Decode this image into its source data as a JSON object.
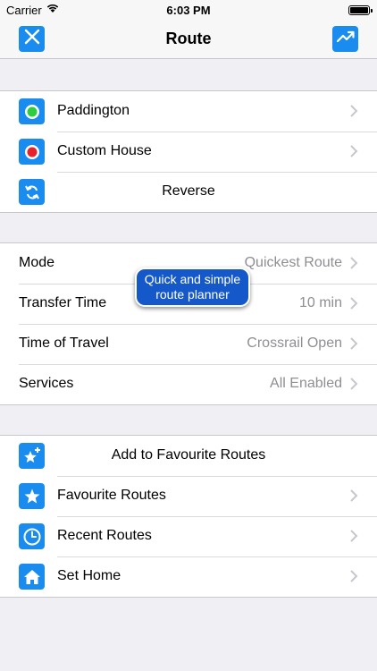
{
  "status_bar": {
    "carrier": "Carrier",
    "time": "6:03 PM"
  },
  "nav": {
    "title": "Route",
    "left_icon": "close-icon",
    "right_icon": "trend-chart-icon"
  },
  "route_section": {
    "origin": {
      "label": "Paddington",
      "icon": "green-dot-icon",
      "color": "#2ecc40"
    },
    "destination": {
      "label": "Custom House",
      "icon": "red-dot-icon",
      "color": "#e8222a"
    },
    "reverse": {
      "label": "Reverse",
      "icon": "reverse-arrows-icon"
    }
  },
  "options_section": {
    "rows": [
      {
        "label": "Mode",
        "value": "Quickest Route"
      },
      {
        "label": "Transfer Time",
        "value": "10 min"
      },
      {
        "label": "Time of Travel",
        "value": "Crossrail Open"
      },
      {
        "label": "Services",
        "value": "All Enabled"
      }
    ]
  },
  "tooltip": {
    "line1": "Quick and simple",
    "line2": "route planner"
  },
  "favourites_section": {
    "add": {
      "label": "Add to Favourite Routes",
      "icon": "star-plus-icon"
    },
    "favourites": {
      "label": "Favourite Routes",
      "icon": "star-icon"
    },
    "recent": {
      "label": "Recent Routes",
      "icon": "clock-icon"
    },
    "home": {
      "label": "Set Home",
      "icon": "home-icon"
    }
  },
  "colors": {
    "accent": "#1a8cf0",
    "tooltip": "#1558c9",
    "secondary_text": "#8e8e93"
  }
}
